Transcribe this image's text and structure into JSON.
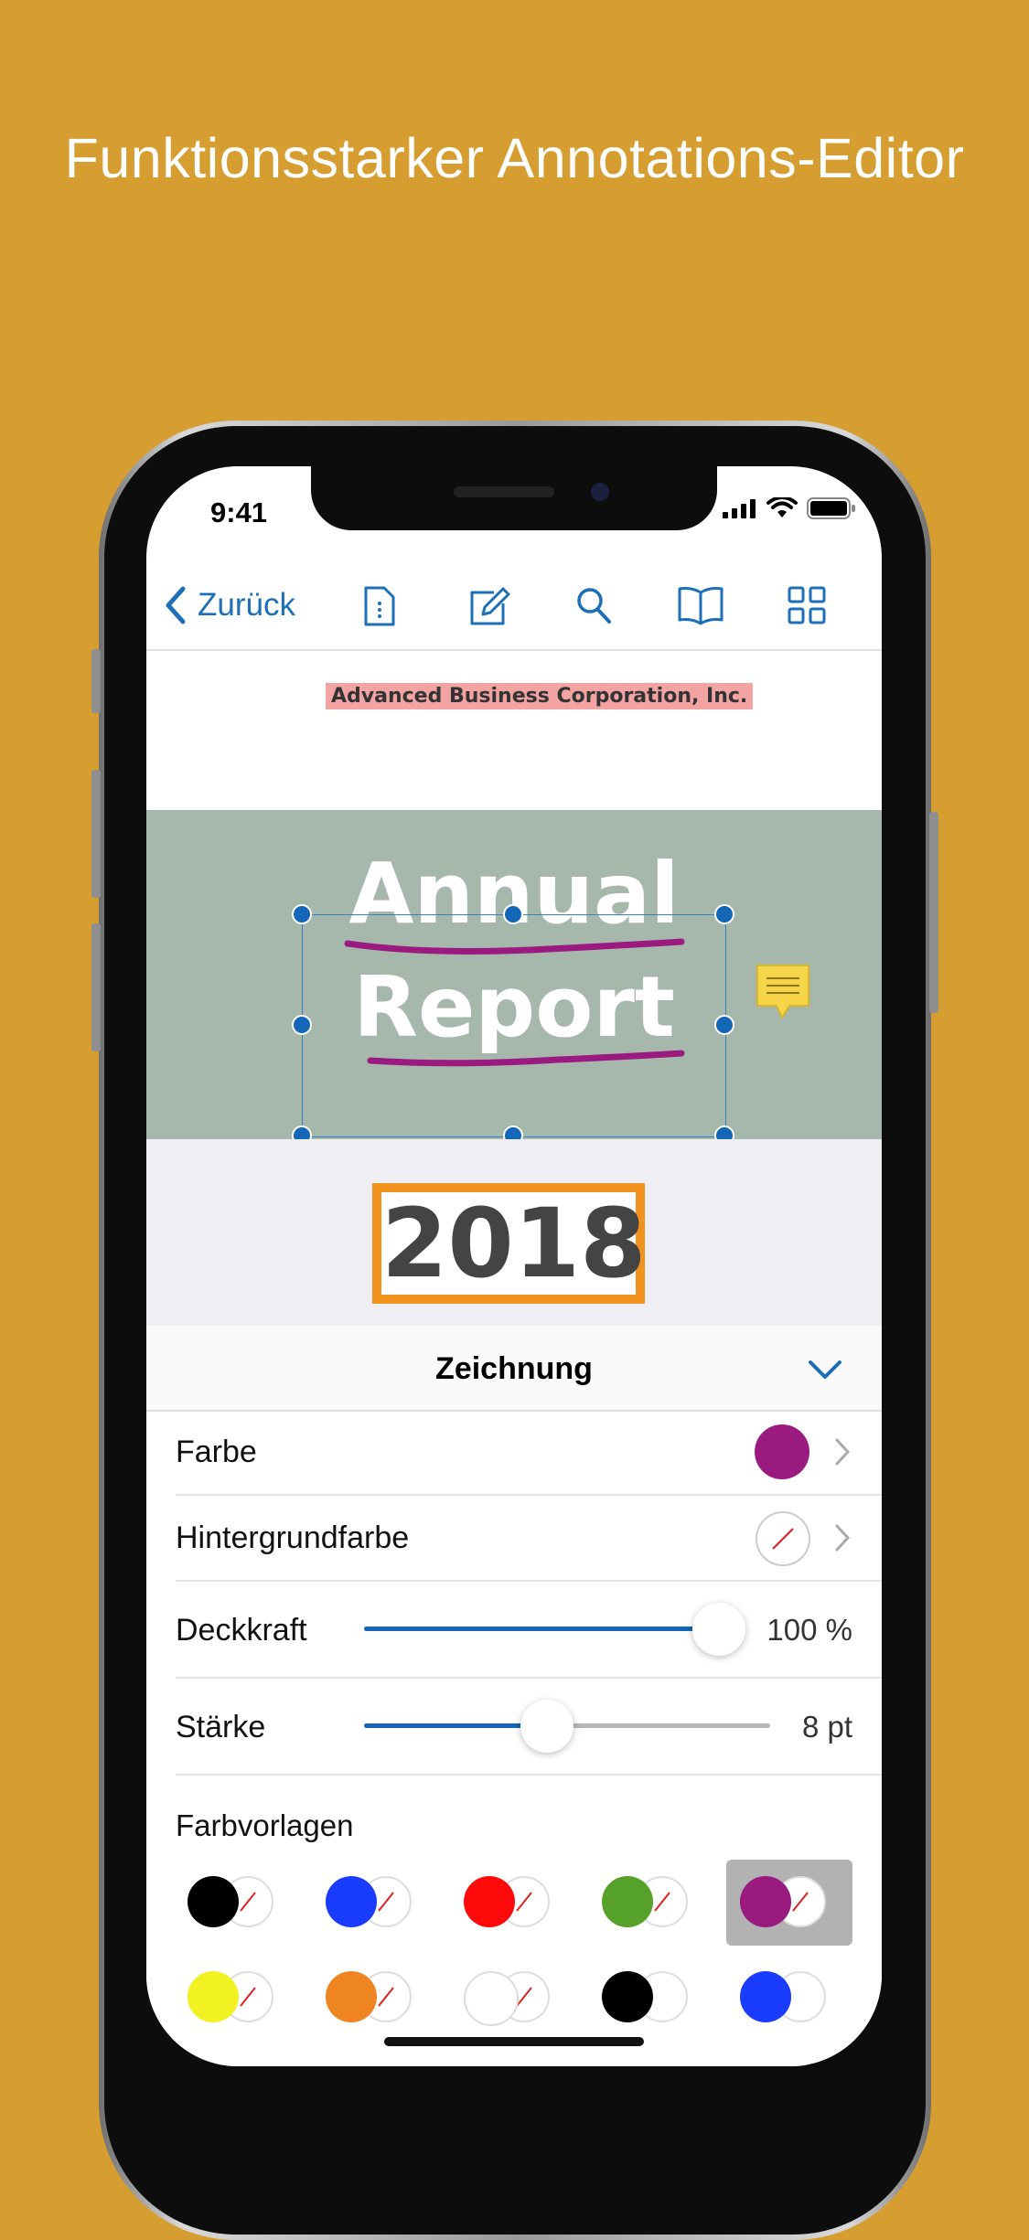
{
  "headline": "Funktionsstarker Annotations-Editor",
  "status": {
    "time": "9:41"
  },
  "toolbar": {
    "back_label": "Zurück",
    "icons": [
      "document-icon",
      "edit-icon",
      "search-icon",
      "book-icon",
      "grid-icon"
    ]
  },
  "document": {
    "company": "Advanced Business Corporation, Inc.",
    "title_line1": "Annual",
    "title_line2": "Report",
    "year": "2018"
  },
  "panel": {
    "title": "Zeichnung",
    "rows": {
      "color_label": "Farbe",
      "background_label": "Hintergrundfarbe",
      "opacity_label": "Deckkraft",
      "opacity_value": "100 %",
      "opacity_fraction": 1.0,
      "stroke_label": "Stärke",
      "stroke_value": "8 pt",
      "stroke_fraction": 0.45
    },
    "presets_label": "Farbvorlagen",
    "presets": [
      {
        "color": "#000000",
        "bg": "none",
        "selected": false
      },
      {
        "color": "#1a3cff",
        "bg": "none",
        "selected": false
      },
      {
        "color": "#ff0a0a",
        "bg": "none",
        "selected": false
      },
      {
        "color": "#56a12a",
        "bg": "none",
        "selected": false
      },
      {
        "color": "#9b1a80",
        "bg": "none",
        "selected": true
      },
      {
        "color": "#f2f222",
        "bg": "none",
        "selected": false
      },
      {
        "color": "#ee8520",
        "bg": "none",
        "selected": false
      },
      {
        "color": "#ffffff",
        "bg": "none",
        "selected": false
      },
      {
        "color": "#000000",
        "bg": "#ffffff",
        "selected": false
      },
      {
        "color": "#1a3cff",
        "bg": "#ffffff",
        "selected": false
      }
    ]
  },
  "colors": {
    "background": "#d69d30",
    "accent": "#1d6fb8",
    "drawing_color": "#9b1a80",
    "highlight": "#f4a3a3",
    "year_border": "#f2931f",
    "title_band": "#a6b8ab"
  }
}
